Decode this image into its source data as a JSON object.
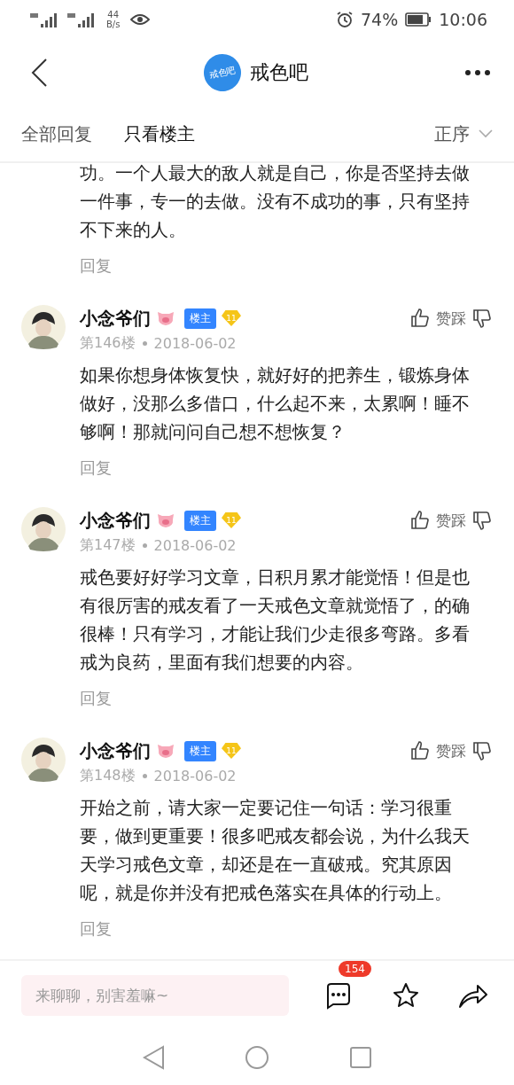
{
  "status_bar": {
    "speed_value": "44",
    "speed_unit": "B/s",
    "battery": "74%",
    "time": "10:06"
  },
  "header": {
    "logo_text": "戒色吧",
    "title": "戒色吧"
  },
  "filter_tabs": [
    {
      "label": "全部回复",
      "selected": false
    },
    {
      "label": "只看楼主",
      "selected": true
    }
  ],
  "sort": "正序",
  "posts": [
    {
      "kind": "partial",
      "body": "功。一个人最大的敌人就是自己，你是否坚持去做一件事，专一的去做。没有不成功的事，只有坚持不下来的人。",
      "reply": "回复"
    },
    {
      "kind": "full",
      "author": "小念爷们",
      "badge": "楼主",
      "level": "11",
      "floor": "第146楼",
      "date": "2018-06-02",
      "vote": "赞踩",
      "body": "如果你想身体恢复快，就好好的把养生，锻炼身体做好，没那么多借口，什么起不来，太累啊！睡不够啊！那就问问自己想不想恢复？",
      "reply": "回复"
    },
    {
      "kind": "full",
      "author": "小念爷们",
      "badge": "楼主",
      "level": "11",
      "floor": "第147楼",
      "date": "2018-06-02",
      "vote": "赞踩",
      "body": "戒色要好好学习文章，日积月累才能觉悟！但是也有很厉害的戒友看了一天戒色文章就觉悟了，的确很棒！只有学习，才能让我们少走很多弯路。多看戒为良药，里面有我们想要的内容。",
      "reply": "回复"
    },
    {
      "kind": "full",
      "author": "小念爷们",
      "badge": "楼主",
      "level": "11",
      "floor": "第148楼",
      "date": "2018-06-02",
      "vote": "赞踩",
      "body": "开始之前，请大家一定要记住一句话：学习很重要，做到更重要！很多吧戒友都会说，为什么我天天学习戒色文章，却还是在一直破戒。究其原因呢，就是你并没有把戒色落实在具体的行动上。",
      "reply": "回复"
    }
  ],
  "bottom_bar": {
    "placeholder": "来聊聊，别害羞嘛~",
    "comment_count": "154"
  }
}
